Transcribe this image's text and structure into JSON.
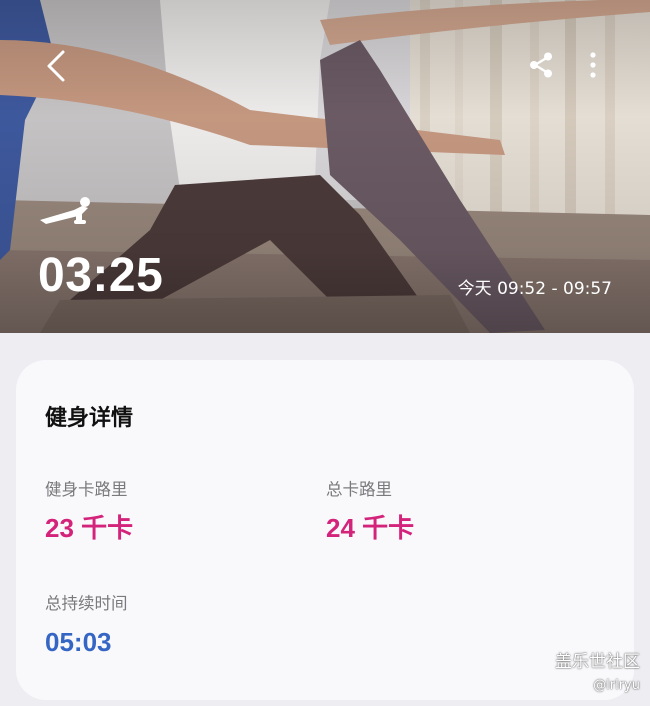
{
  "header": {
    "back_icon": "chevron-left-icon",
    "share_icon": "share-icon",
    "more_icon": "more-vertical-icon",
    "workout_icon": "plank-workout-icon"
  },
  "hero": {
    "duration": "03:25",
    "time_range": "今天 09:52 - 09:57"
  },
  "details": {
    "title": "健身详情",
    "workout_calories": {
      "label": "健身卡路里",
      "value": "23 千卡",
      "color": "#d4237a"
    },
    "total_calories": {
      "label": "总卡路里",
      "value": "24 千卡",
      "color": "#d4237a"
    },
    "total_duration": {
      "label": "总持续时间",
      "value": "05:03",
      "color": "#3566c4"
    }
  },
  "watermark": {
    "brand": "盖乐世社区",
    "user": "@lrlryu"
  }
}
